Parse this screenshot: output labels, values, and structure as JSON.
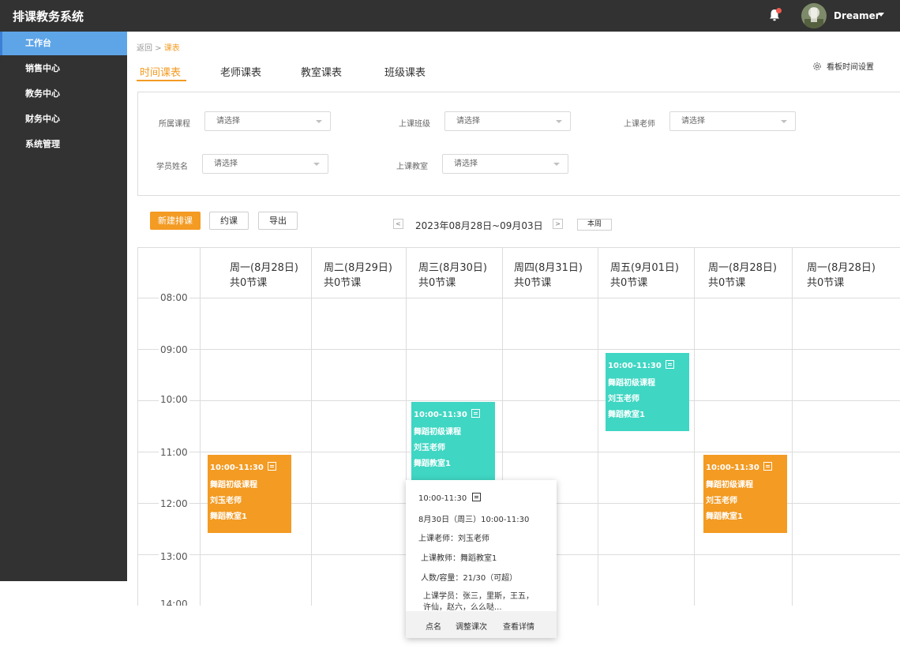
{
  "app": {
    "title": "排课教务系统"
  },
  "user": {
    "name": "Dreamer",
    "has_notification": true
  },
  "colors": {
    "accent": "#f39b23",
    "teal": "#3fd6c3",
    "sidebar": "#323232",
    "active": "#5ea5e8"
  },
  "sidebar": {
    "items": [
      {
        "label": "工作台",
        "active": true
      },
      {
        "label": "销售中心"
      },
      {
        "label": "教务中心"
      },
      {
        "label": "财务中心"
      },
      {
        "label": "系统管理"
      }
    ]
  },
  "breadcrumb": {
    "back": "返回",
    "sep": ">",
    "current": "课表"
  },
  "tabs": [
    {
      "label": "时间课表",
      "active": true
    },
    {
      "label": "老师课表"
    },
    {
      "label": "教室课表"
    },
    {
      "label": "班级课表"
    }
  ],
  "board_setting": "看板时间设置",
  "filters": {
    "course": {
      "label": "所属课程",
      "placeholder": "请选择"
    },
    "class": {
      "label": "上课班级",
      "placeholder": "请选择"
    },
    "teacher": {
      "label": "上课老师",
      "placeholder": "请选择"
    },
    "student": {
      "label": "学员姓名",
      "placeholder": "请选择"
    },
    "room": {
      "label": "上课教室",
      "placeholder": "请选择"
    }
  },
  "toolbar": {
    "new": "新建排课",
    "book": "约课",
    "export": "导出",
    "prev": "<",
    "next": ">",
    "range": "2023年08月28日~09月03日",
    "this_week": "本周"
  },
  "days": [
    {
      "name": "周一(8月28日)",
      "count": "共0节课"
    },
    {
      "name": "周二(8月29日)",
      "count": "共0节课"
    },
    {
      "name": "周三(8月30日)",
      "count": "共0节课"
    },
    {
      "name": "周四(8月31日)",
      "count": "共0节课"
    },
    {
      "name": "周五(9月01日)",
      "count": "共0节课"
    },
    {
      "name": "周一(8月28日)",
      "count": "共0节课"
    },
    {
      "name": "周一(8月28日)",
      "count": "共0节课"
    }
  ],
  "times": [
    "08:00",
    "09:00",
    "10:00",
    "11:00",
    "12:00",
    "13:00",
    "14:00"
  ],
  "events": [
    {
      "day": 0,
      "time": "10:00-11:30",
      "course": "舞蹈初级课程",
      "teacher": "刘玉老师",
      "room": "舞蹈教室1",
      "color": "orange"
    },
    {
      "day": 2,
      "time": "10:00-11:30",
      "course": "舞蹈初级课程",
      "teacher": "刘玉老师",
      "room": "舞蹈教室1",
      "color": "teal"
    },
    {
      "day": 4,
      "time": "10:00-11:30",
      "course": "舞蹈初级课程",
      "teacher": "刘玉老师",
      "room": "舞蹈教室1",
      "color": "teal"
    },
    {
      "day": 5,
      "time": "10:00-11:30",
      "course": "舞蹈初级课程",
      "teacher": "刘玉老师",
      "room": "舞蹈教室1",
      "color": "orange"
    }
  ],
  "popover": {
    "time": "10:00-11:30",
    "date": "8月30日（周三）10:00-11:30",
    "teacher": "上课老师：刘玉老师",
    "room": "上课教师：舞蹈教室1",
    "capacity": "人数/容量：21/30（可超）",
    "students_1": "上课学员：张三，里斯，王五，",
    "students_2": "许仙，赵六，么么哒...",
    "actions": {
      "rollcall": "点名",
      "adjust": "调整课次",
      "detail": "查看详情"
    }
  }
}
